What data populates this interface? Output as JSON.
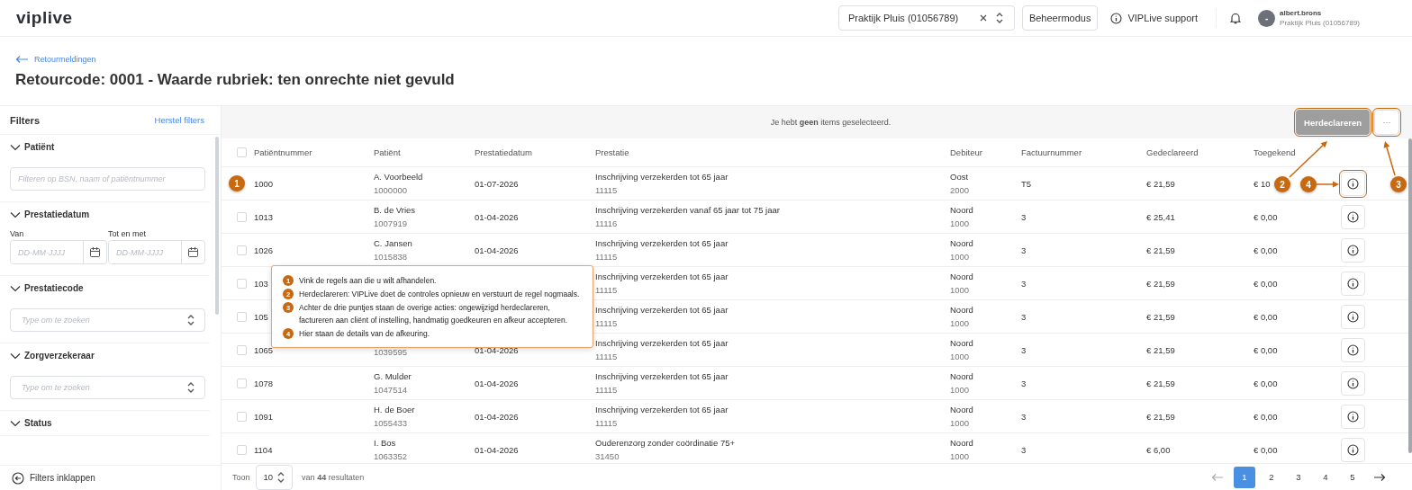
{
  "topbar": {
    "logo": "viplive",
    "practice_select": {
      "value": "Praktijk Pluis (01056789)"
    },
    "mode_button": "Beheermodus",
    "support_link": "VIPLive support",
    "user": {
      "initial": "-",
      "name": "albert.brons",
      "organisation": "Praktijk Pluis (01056789)"
    }
  },
  "breadcrumb": "Retourmeldingen",
  "title": "Retourcode: 0001 - Waarde rubriek: ten onrechte niet gevuld",
  "sidebar": {
    "title": "Filters",
    "reset_link": "Herstel filters",
    "sections": [
      {
        "kind": "text",
        "label": "Patiënt",
        "expanded": true,
        "placeholder": "Filteren op BSN, naam of patiëntnummer"
      },
      {
        "kind": "daterange",
        "label": "Prestatiedatum",
        "expanded": true,
        "from_label": "Van",
        "to_label": "Tot en met",
        "from_placeholder": "DD-MM-JJJJ",
        "to_placeholder": "DD-MM-JJJJ"
      },
      {
        "kind": "select",
        "label": "Prestatiecode",
        "expanded": true,
        "placeholder": "Type om te zoeken"
      },
      {
        "kind": "select",
        "label": "Zorgverzekeraar",
        "expanded": true,
        "placeholder": "Type om te zoeken"
      },
      {
        "kind": "none",
        "label": "Status",
        "expanded": true
      }
    ],
    "collapse_link": "Filters inklappen"
  },
  "action_bar": {
    "message": "Je hebt **geen** items geselecteerd.",
    "primary_button": {
      "label": "Herdeclareren",
      "disabled": true,
      "highlighted": true
    },
    "more_button": {
      "label": "···",
      "highlighted": true
    }
  },
  "table": {
    "select_all": {
      "checked": false
    },
    "columns": [
      "Patiëntnummer",
      "Patiënt",
      "Prestatiedatum",
      "Prestatie",
      "Debiteur",
      "Factuurnummer",
      "Gedeclareerd",
      "Toegekend"
    ],
    "rows": [
      {
        "patientnummer": "1000",
        "patient": "A. Voorbeeld",
        "patient_nr": "1000000",
        "datum": "01-07-2026",
        "prestatie": "Inschrijving verzekerden tot 65 jaar",
        "code": "11115",
        "debiteur": "Oost",
        "debiteur_nr": "2000",
        "factuur": "T5",
        "gedeclareerd": "€ 21,59",
        "toegekend": "€ 10",
        "info_highlighted": true
      },
      {
        "checked": false,
        "patientnummer": "1013",
        "patient": "B. de Vries",
        "patient_nr": "1007919",
        "datum": "01-04-2026",
        "prestatie": "Inschrijving verzekerden vanaf 65 jaar tot 75 jaar",
        "code": "11116",
        "debiteur": "Noord",
        "debiteur_nr": "1000",
        "factuur": "3",
        "gedeclareerd": "€ 25,41",
        "toegekend": "€ 0,00",
        "info_highlighted": false
      },
      {
        "checked": false,
        "patientnummer": "1026",
        "patient": "C. Jansen",
        "patient_nr": "1015838",
        "datum": "01-04-2026",
        "prestatie": "Inschrijving verzekerden tot 65 jaar",
        "code": "11115",
        "debiteur": "Noord",
        "debiteur_nr": "1000",
        "factuur": "3",
        "gedeclareerd": "€ 21,59",
        "toegekend": "€ 0,00",
        "info_highlighted": false
      },
      {
        "checked": false,
        "patientnummer": "103",
        "prestatie": "Inschrijving verzekerden tot 65 jaar",
        "code": "11115",
        "debiteur": "Noord",
        "debiteur_nr": "1000",
        "factuur": "3",
        "gedeclareerd": "€ 21,59",
        "toegekend": "€ 0,00",
        "info_highlighted": false
      },
      {
        "checked": false,
        "patientnummer": "105",
        "prestatie": "Inschrijving verzekerden tot 65 jaar",
        "code": "11115",
        "debiteur": "Noord",
        "debiteur_nr": "1000",
        "factuur": "3",
        "gedeclareerd": "€ 21,59",
        "toegekend": "€ 0,00",
        "info_highlighted": false
      },
      {
        "checked": false,
        "patientnummer": "1065",
        "patient_nr": "1039595",
        "datum": "01-04-2026",
        "prestatie": "Inschrijving verzekerden tot 65 jaar",
        "code": "11115",
        "debiteur": "Noord",
        "debiteur_nr": "1000",
        "factuur": "3",
        "gedeclareerd": "€ 21,59",
        "toegekend": "€ 0,00",
        "info_highlighted": false
      },
      {
        "checked": false,
        "patientnummer": "1078",
        "patient": "G. Mulder",
        "patient_nr": "1047514",
        "datum": "01-04-2026",
        "prestatie": "Inschrijving verzekerden tot 65 jaar",
        "code": "11115",
        "debiteur": "Noord",
        "debiteur_nr": "1000",
        "factuur": "3",
        "gedeclareerd": "€ 21,59",
        "toegekend": "€ 0,00",
        "info_highlighted": false
      },
      {
        "checked": false,
        "patientnummer": "1091",
        "patient": "H. de Boer",
        "patient_nr": "1055433",
        "datum": "01-04-2026",
        "prestatie": "Inschrijving verzekerden tot 65 jaar",
        "code": "11115",
        "debiteur": "Noord",
        "debiteur_nr": "1000",
        "factuur": "3",
        "gedeclareerd": "€ 21,59",
        "toegekend": "€ 0,00",
        "info_highlighted": false
      },
      {
        "checked": false,
        "patientnummer": "1104",
        "patient": "I. Bos",
        "patient_nr": "1063352",
        "datum": "01-04-2026",
        "prestatie": "Ouderenzorg zonder coördinatie 75+",
        "code": "31450",
        "debiteur": "Noord",
        "debiteur_nr": "1000",
        "factuur": "3",
        "gedeclareerd": "€ 6,00",
        "toegekend": "€ 0,00",
        "info_highlighted": false
      }
    ]
  },
  "footer": {
    "show_label": "Toon",
    "page_size": "10",
    "results": "van **44** resultaten",
    "pages": [
      {
        "label": "1",
        "selected": true
      },
      {
        "label": "2",
        "selected": false
      },
      {
        "label": "3",
        "selected": false
      },
      {
        "label": "4",
        "selected": false
      },
      {
        "label": "5",
        "selected": false
      }
    ],
    "prev_disabled": true,
    "next_disabled": false
  },
  "help_tooltip": {
    "items": [
      {
        "number": "1",
        "text": "Vink de regels aan die u wilt afhandelen."
      },
      {
        "number": "2",
        "text": "Herdeclareren: VIPLive doet de controles opnieuw en verstuurt de regel nogmaals."
      },
      {
        "number": "3",
        "text": "Achter de drie puntjes staan de overige acties: ongewijzigd herdeclareren, factureren aan cliënt of instelling, handmatig goedkeuren en afkeur accepteren."
      },
      {
        "number": "4",
        "text": "Hier staan de details van de afkeuring."
      }
    ]
  },
  "callouts": [
    {
      "number": "1"
    },
    {
      "number": "2"
    },
    {
      "number": "4"
    },
    {
      "number": "3"
    }
  ]
}
